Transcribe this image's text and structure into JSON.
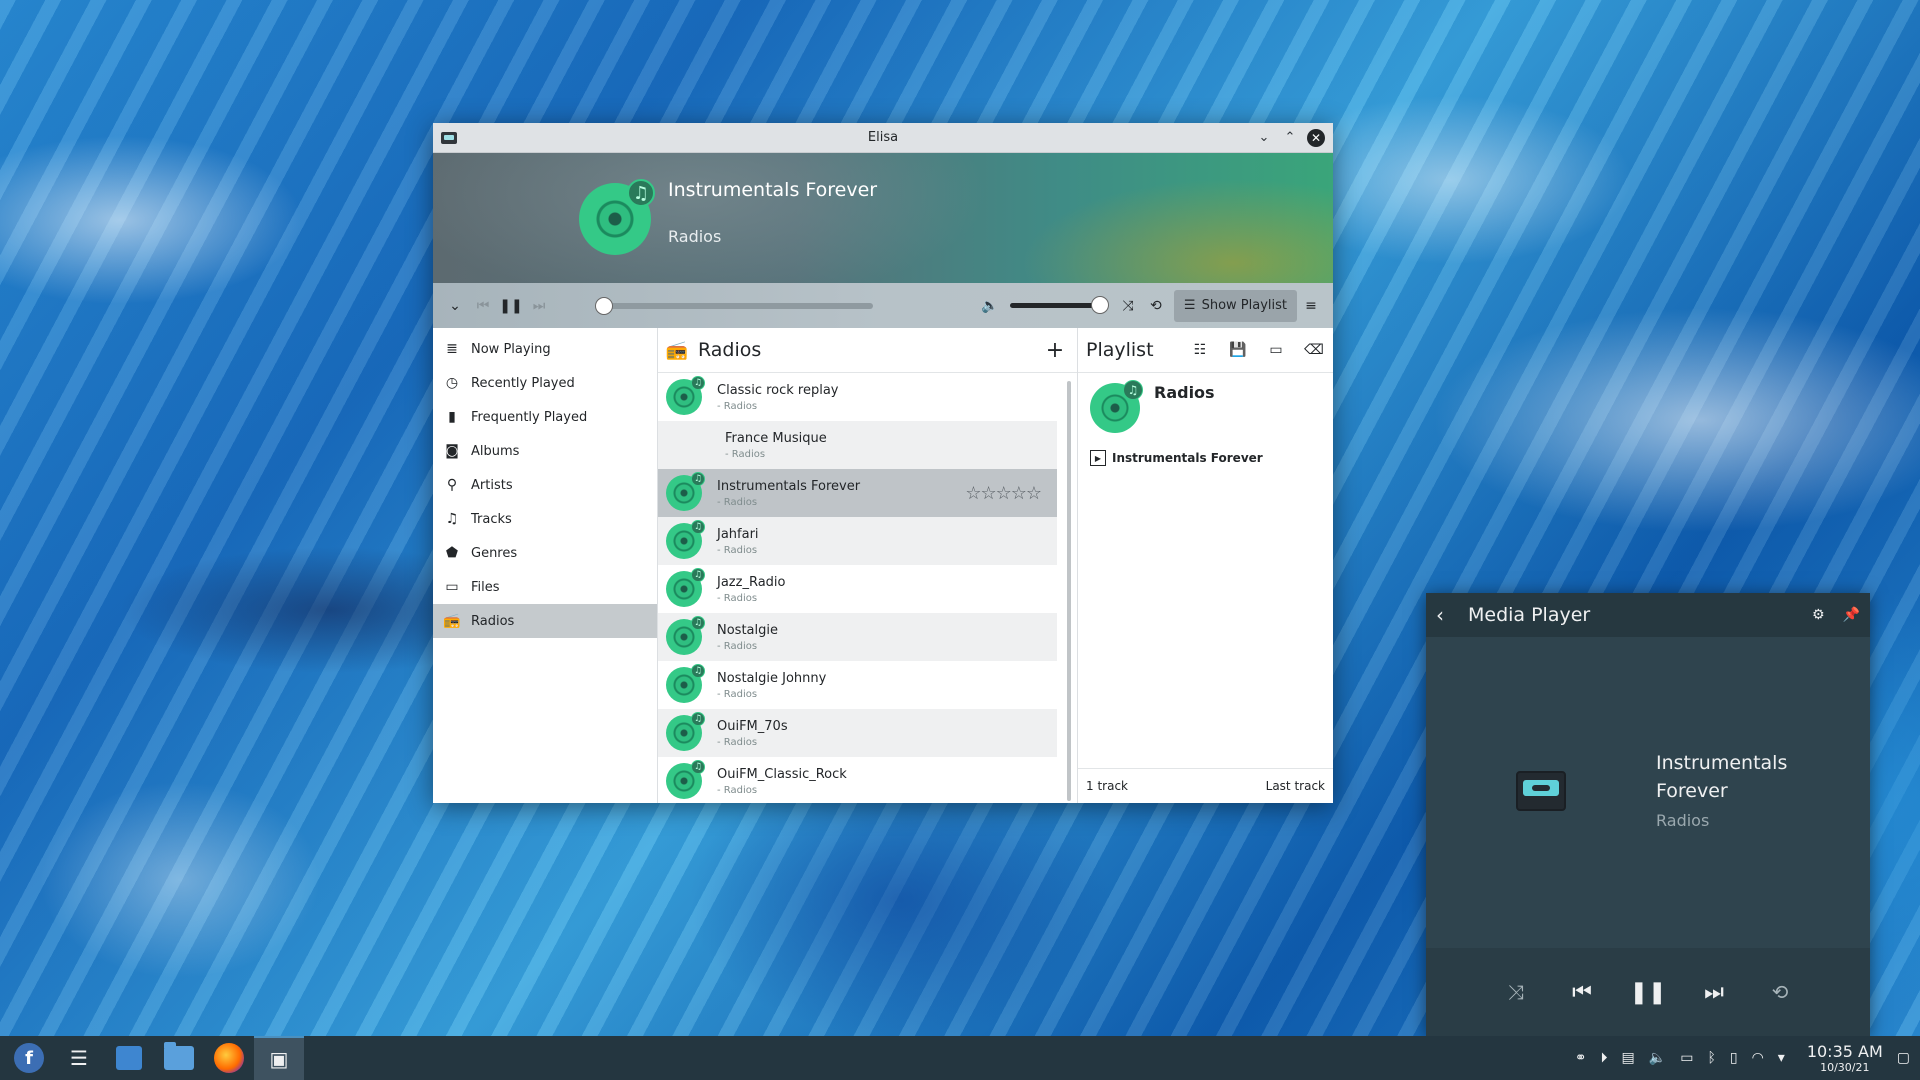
{
  "window": {
    "title": "Elisa",
    "now_playing": {
      "title": "Instrumentals Forever",
      "subtitle": "Radios"
    },
    "show_playlist_label": "Show Playlist",
    "sidebar": [
      {
        "label": "Now Playing",
        "icon": "now-playing-icon"
      },
      {
        "label": "Recently Played",
        "icon": "clock-icon"
      },
      {
        "label": "Frequently Played",
        "icon": "bar-chart-icon"
      },
      {
        "label": "Albums",
        "icon": "album-icon"
      },
      {
        "label": "Artists",
        "icon": "person-icon"
      },
      {
        "label": "Tracks",
        "icon": "music-note-icon"
      },
      {
        "label": "Genres",
        "icon": "genre-icon"
      },
      {
        "label": "Files",
        "icon": "folder-icon"
      },
      {
        "label": "Radios",
        "icon": "radio-icon",
        "active": true
      }
    ],
    "radios": {
      "title": "Radios",
      "rows": [
        {
          "name": "Classic rock replay",
          "sub": "- Radios"
        },
        {
          "name": "France Musique",
          "sub": "- Radios"
        },
        {
          "name": "Instrumentals Forever",
          "sub": "- Radios",
          "rating_stars": "☆☆☆☆☆"
        },
        {
          "name": "Jahfari",
          "sub": "- Radios"
        },
        {
          "name": "Jazz_Radio",
          "sub": "- Radios"
        },
        {
          "name": "Nostalgie",
          "sub": "- Radios"
        },
        {
          "name": "Nostalgie Johnny",
          "sub": "- Radios"
        },
        {
          "name": "OuiFM_70s",
          "sub": "- Radios"
        },
        {
          "name": "OuiFM_Classic_Rock",
          "sub": "- Radios"
        }
      ]
    },
    "playlist": {
      "title": "Playlist",
      "group_name": "Radios",
      "track": "Instrumentals Forever",
      "count_label": "1 track",
      "last_label": "Last track"
    }
  },
  "media_player": {
    "title": "Media Player",
    "track": "Instrumentals Forever",
    "artist": "Radios"
  },
  "taskbar": {
    "time": "10:35 AM",
    "date": "10/30/21"
  }
}
